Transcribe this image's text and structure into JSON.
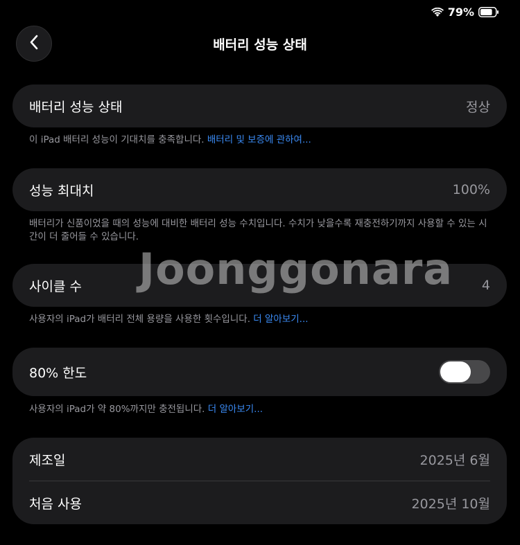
{
  "status": {
    "battery_percent": "79%",
    "wifi_icon": "wifi-icon",
    "battery_icon": "battery-icon",
    "battery_level": 0.79
  },
  "header": {
    "title": "배터리 성능 상태",
    "back_icon": "chevron-left-icon"
  },
  "health": {
    "label": "배터리 성능 상태",
    "value": "정상",
    "note_text": "이 iPad 배터리 성능이 기대치를 충족합니다. ",
    "note_link": "배터리 및 보증에 관하여..."
  },
  "max_capacity": {
    "label": "성능 최대치",
    "value": "100%",
    "note_text": "배터리가 신품이었을 때의 성능에 대비한 배터리 성능 수치입니다. 수치가 낮을수록 재충전하기까지 사용할 수 있는 시간이 더 줄어들 수 있습니다."
  },
  "cycle_count": {
    "label": "사이클 수",
    "value": "4",
    "note_text": "사용자의 iPad가 배터리 전체 용량을 사용한 횟수입니다. ",
    "note_link": "더 알아보기..."
  },
  "limit": {
    "label": "80% 한도",
    "toggle_on": false,
    "note_text": "사용자의 iPad가 약 80%까지만 충전됩니다. ",
    "note_link": "더 알아보기..."
  },
  "dates": {
    "manufacture_label": "제조일",
    "manufacture_value": "2025년 6월",
    "first_use_label": "처음 사용",
    "first_use_value": "2025년 10월"
  },
  "watermark": "Joonggonara",
  "colors": {
    "background": "#000000",
    "cell": "#1c1c1e",
    "link": "#3b8bf5",
    "secondary_text": "#98989e"
  }
}
